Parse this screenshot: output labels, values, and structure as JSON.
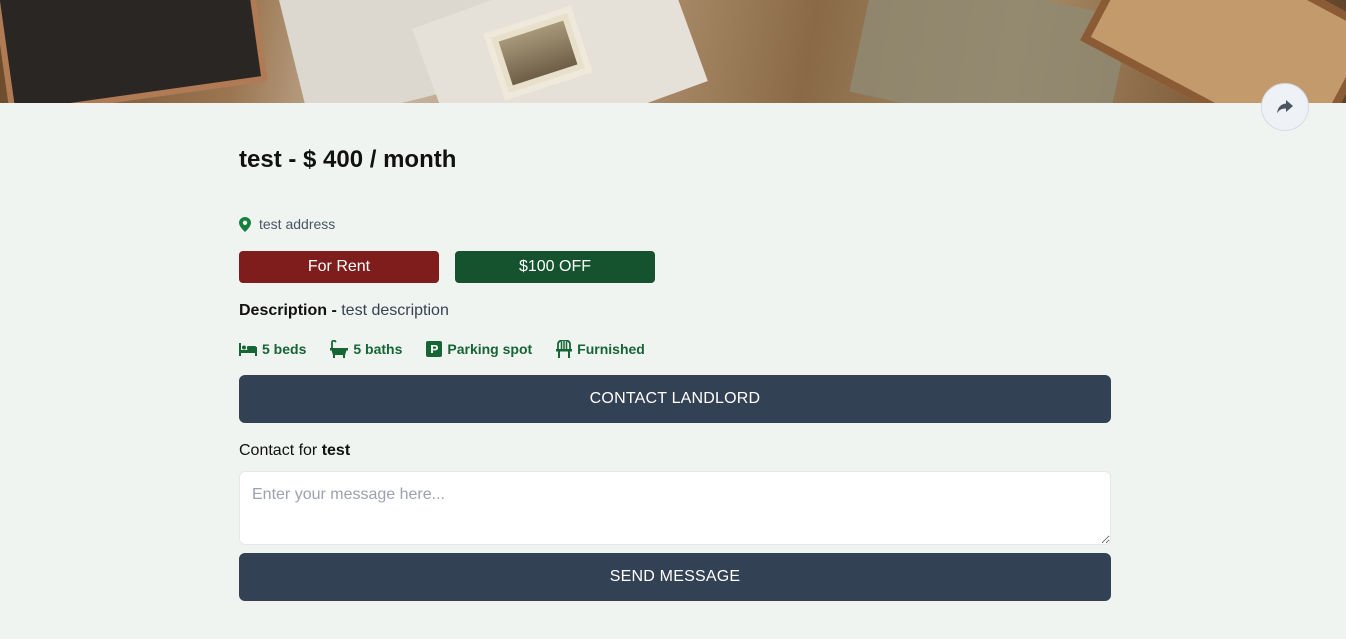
{
  "hero": {
    "image": "bedroom-photo-banner"
  },
  "share": {
    "icon": "share-arrow-icon"
  },
  "listing": {
    "name": "test",
    "separator": "-",
    "price": "$ 400 / month",
    "address": "test address",
    "tags": {
      "rent": "For Rent",
      "discount": "$100 OFF"
    },
    "description_label": "Description",
    "description_sep": " - ",
    "description": "test description",
    "amenities": {
      "beds": "5 beds",
      "baths": "5 baths",
      "parking": "Parking spot",
      "furnished": "Furnished"
    }
  },
  "actions": {
    "contact": "CONTACT LANDLORD",
    "contact_for_prefix": "Contact for ",
    "contact_for_name": "test",
    "message_placeholder": "Enter your message here...",
    "send": "SEND MESSAGE"
  },
  "colors": {
    "rent_tag": "#7f1d1d",
    "discount_tag": "#14532d",
    "primary_button": "#334155",
    "amenity_text": "#166534",
    "background": "#f0f4f1"
  }
}
